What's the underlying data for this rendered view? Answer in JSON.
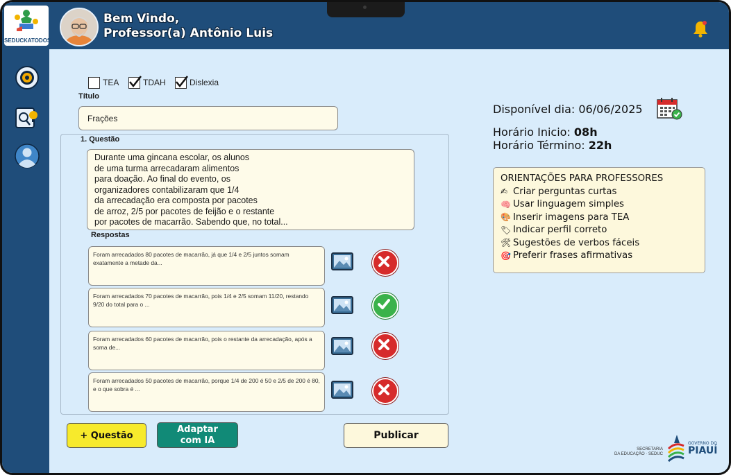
{
  "app": {
    "logo_text": "SEDUCKATODOS",
    "welcome_line1": "Bem Vindo,",
    "welcome_line2": "Professor(a) Antônio Luis"
  },
  "sidebar": {
    "items": [
      {
        "icon": "gear-icon"
      },
      {
        "icon": "ideas-icon"
      },
      {
        "icon": "user-icon"
      }
    ]
  },
  "filters": {
    "options": [
      {
        "label": "TEA",
        "checked": false
      },
      {
        "label": "TDAH",
        "checked": true
      },
      {
        "label": "Dislexia",
        "checked": true
      }
    ]
  },
  "form": {
    "title_label": "Título",
    "title_value": "Frações",
    "question_label": "1. Questão",
    "question_text": "Durante uma gincana escolar, os alunos\nde uma turma arrecadaram alimentos\npara doação. Ao final do evento, os\norganizadores contabilizaram que 1/4\nda arrecadação era composta por pacotes\nde arroz, 2/5 por pacotes de feijão e o restante\npor pacotes de macarrão. Sabendo que, no total...",
    "answers_label": "Respostas",
    "answers": [
      {
        "text": "Foram arrecadados 80 pacotes de macarrão, já que  1/4 e 2/5 juntos somam exatamente a metade da...",
        "correct": false
      },
      {
        "text": "Foram arrecadados 70 pacotes de macarrão, pois 1/4 e 2/5 somam 11/20, restando 9/20 do total para o ...",
        "correct": true
      },
      {
        "text": "Foram arrecadados 60 pacotes de macarrão, pois o restante da arrecadação, após a soma de...",
        "correct": false
      },
      {
        "text": "Foram arrecadados 50 pacotes de macarrão, porque 1/4 de 200 é 50 e 2/5 de 200 é 80, e o que sobra é ...",
        "correct": false
      }
    ]
  },
  "buttons": {
    "add_question": "+ Questão",
    "adapt_ai_line1": "Adaptar",
    "adapt_ai_line2": "com IA",
    "publish": "Publicar"
  },
  "schedule": {
    "available_label": "Disponível dia: 06/06/2025",
    "start_label": "Horário Inicio: ",
    "start_value": "08h",
    "end_label": "Horário Término: ",
    "end_value": "22h"
  },
  "guidelines": {
    "title": "ORIENTAÇÕES PARA PROFESSORES",
    "items": [
      {
        "icon": "✍",
        "text": "Criar perguntas curtas"
      },
      {
        "icon": "🧠",
        "text": "Usar linguagem simples"
      },
      {
        "icon": "🎨",
        "text": "Inserir imagens para TEA"
      },
      {
        "icon": "🏷",
        "text": "Indicar perfil correto"
      },
      {
        "icon": "🛠",
        "text": "Sugestões de verbos fáceis"
      },
      {
        "icon": "🎯",
        "text": "Preferir frases afirmativas"
      }
    ]
  },
  "footer": {
    "secretaria_line1": "SECRETARIA",
    "secretaria_line2": "DA EDUCAÇÃO · SEDUC",
    "gov_line1": "GOVERNO DO",
    "gov_line2": "PIAUÍ"
  },
  "colors": {
    "primary": "#1f4d7a",
    "background": "#d9ecfb",
    "card": "#fdf8dc",
    "add_button": "#f7ea2c",
    "ai_button": "#118a77",
    "wrong": "#d62b2b",
    "right": "#3bb24b"
  }
}
